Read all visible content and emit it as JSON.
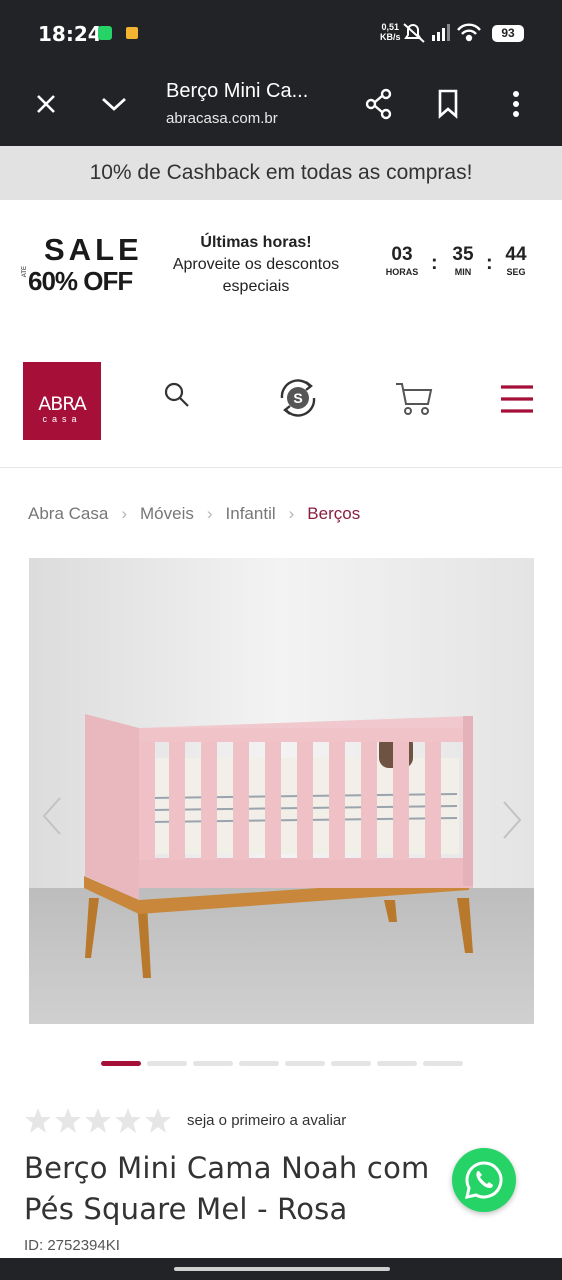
{
  "status_bar": {
    "time": "18:24",
    "net_speed_value": "0,51",
    "net_speed_unit": "KB/s",
    "battery": "93",
    "icons": [
      "whatsapp-notification-icon",
      "message-notification-icon",
      "mute-icon",
      "signal-icon",
      "wifi-icon",
      "battery-icon"
    ]
  },
  "browser": {
    "tab_title": "Berço Mini Ca...",
    "url": "abracasa.com.br",
    "icons": [
      "close-icon",
      "chevron-down-icon",
      "share-icon",
      "bookmark-icon",
      "more-vert-icon"
    ]
  },
  "promo_bar": {
    "text": "10% de Cashback em todas as compras!"
  },
  "sale_banner": {
    "sale_word": "SALE",
    "up_to": "ATÉ",
    "percent": "60% OFF",
    "headline": "Últimas horas!",
    "subtext": "Aproveite os descontos especiais",
    "countdown": {
      "hours": "03",
      "hours_label": "HORAS",
      "minutes": "35",
      "minutes_label": "MIN",
      "seconds": "44",
      "seconds_label": "SEG"
    }
  },
  "header": {
    "logo_main": "ABRA",
    "logo_sub": "casa",
    "icons": [
      "search-icon",
      "cashback-icon",
      "cart-icon",
      "menu-icon"
    ]
  },
  "breadcrumb": {
    "items": [
      "Abra Casa",
      "Móveis",
      "Infantil",
      "Berços"
    ]
  },
  "gallery": {
    "slide_count": 8,
    "active_index": 0
  },
  "product": {
    "rating_stars": 0,
    "rating_max": 5,
    "rating_text": "seja o primeiro a avaliar",
    "title": "Berço Mini Cama Noah com Pés Square Mel - Rosa",
    "id_text": "ID: 2752394KI"
  },
  "colors": {
    "brand": "#a50f38",
    "breadcrumb_active": "#8a1f3f",
    "whatsapp": "#25d366",
    "system_bar": "#222326"
  }
}
